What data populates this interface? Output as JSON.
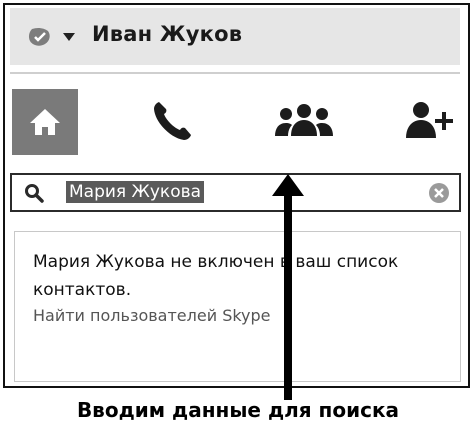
{
  "header": {
    "user_name": "Иван Жуков"
  },
  "nav": {
    "items": [
      {
        "icon": "home-icon"
      },
      {
        "icon": "phone-icon"
      },
      {
        "icon": "contacts-icon"
      },
      {
        "icon": "add-contact-icon"
      }
    ]
  },
  "search": {
    "query": "Мария Жукова"
  },
  "result": {
    "message": "Мария Жукова не включен в ваш список контактов.",
    "link": "Найти пользователей Skype"
  },
  "caption": "Вводим данные для поиска",
  "colors": {
    "header_bg": "#e6e6e6",
    "active_nav_bg": "#7a7a7a",
    "selection_bg": "#5a5a5a"
  }
}
